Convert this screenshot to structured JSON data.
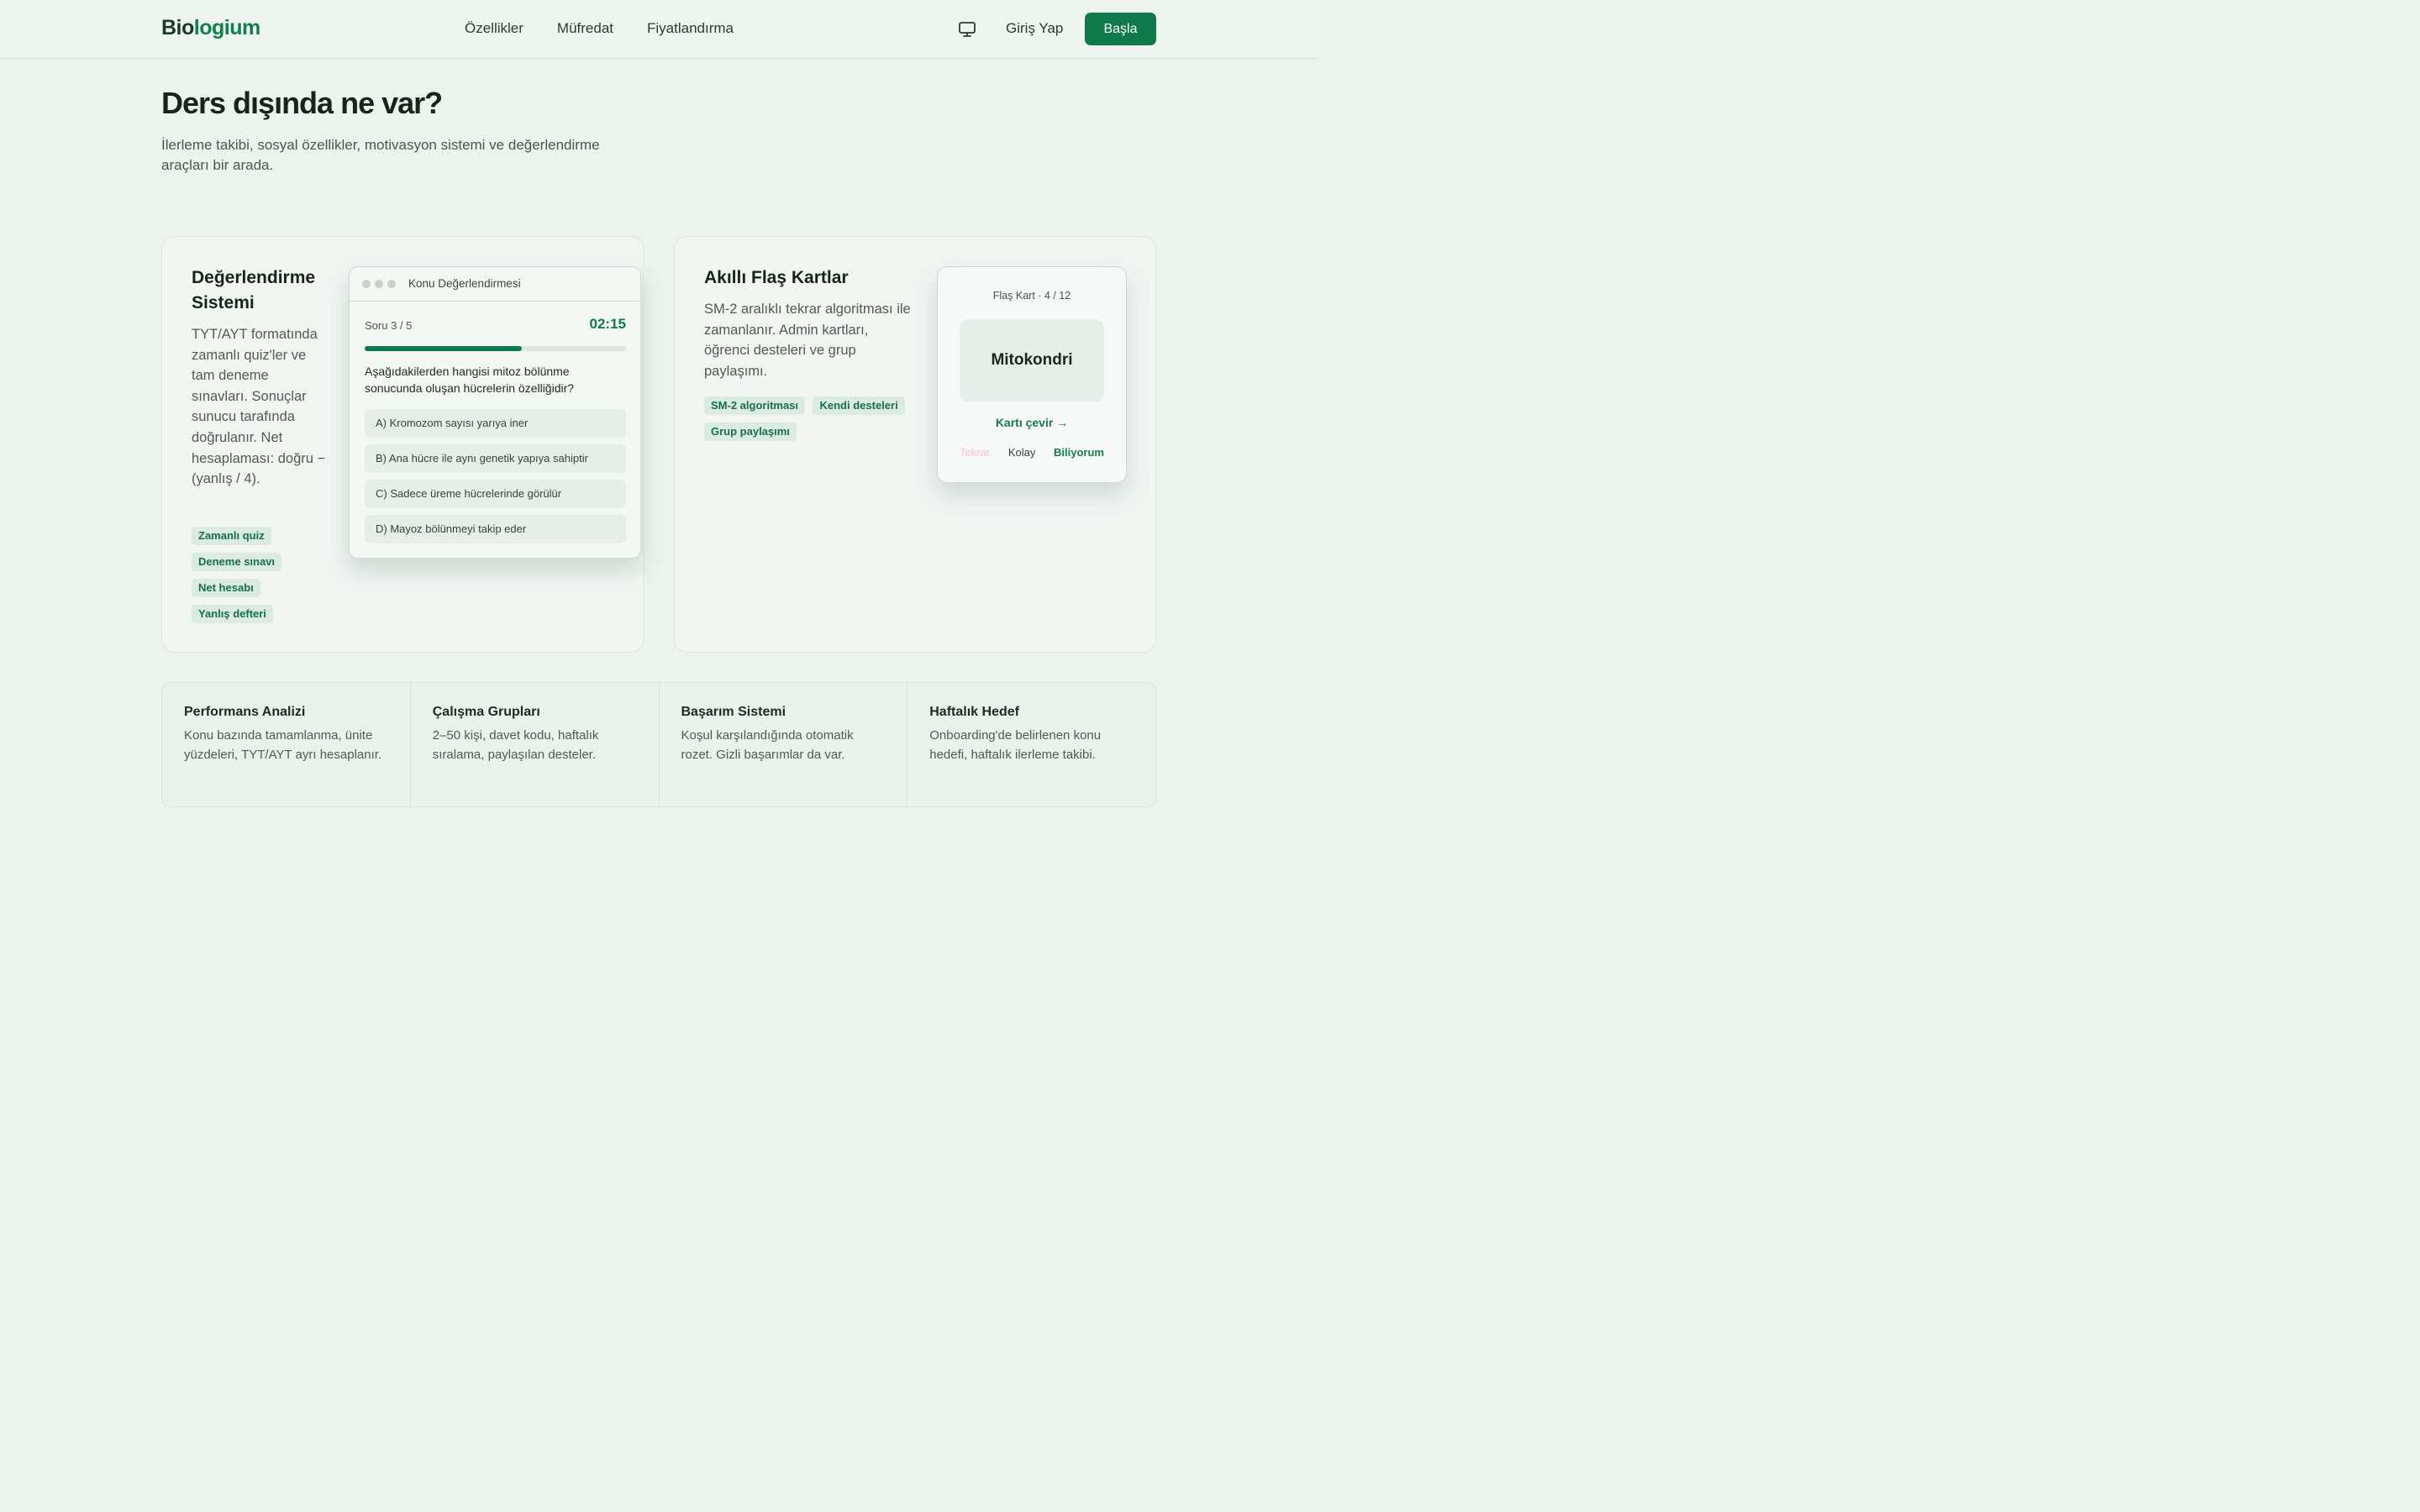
{
  "nav": {
    "logo_a": "Bio",
    "logo_b": "logium",
    "links": [
      "Özellikler",
      "Müfredat",
      "Fiyatlandırma"
    ],
    "login": "Giriş Yap",
    "cta": "Başla"
  },
  "header": {
    "title": "Ders dışında ne var?",
    "lead": "İlerleme takibi, sosyal özellikler, motivasyon sistemi ve değerlendirme araçları bir arada."
  },
  "assessment": {
    "title": "Değerlendirme Sistemi",
    "desc": "TYT/AYT formatında zamanlı quiz'ler ve tam deneme sınavları. Sonuçlar sunucu tarafında doğrulanır. Net hesaplaması: doğru − (yanlış / 4).",
    "tags": [
      "Zamanlı quiz",
      "Deneme sınavı",
      "Net hesabı",
      "Yanlış defteri"
    ],
    "quiz": {
      "window_title": "Konu Değerlendirmesi",
      "counter": "Soru 3 / 5",
      "timer": "02:15",
      "progress": 0.6,
      "question": "Aşağıdakilerden hangisi mitoz bölünme sonucunda oluşan hücrelerin özelliğidir?",
      "options": [
        "A) Kromozom sayısı yarıya iner",
        "B) Ana hücre ile aynı genetik yapıya sahiptir",
        "C) Sadece üreme hücrelerinde görülür",
        "D) Mayoz bölünmeyi takip eder"
      ]
    }
  },
  "flashcards": {
    "title": "Akıllı Flaş Kartlar",
    "desc": "SM-2 aralıklı tekrar algoritması ile zamanlanır. Admin kartları, öğrenci desteleri ve grup paylaşımı.",
    "tags": [
      "SM-2 algoritması",
      "Kendi desteleri",
      "Grup paylaşımı"
    ],
    "widget": {
      "header": "Flaş Kart · 4 / 12",
      "term": "Mitokondri",
      "flip": "Kartı çevir →",
      "answers": [
        "Tekrar",
        "Kolay",
        "Biliyorum"
      ]
    }
  },
  "features": [
    {
      "title": "Performans Analizi",
      "desc": "Konu bazında tamamlanma, ünite yüzdeleri, TYT/AYT ayrı hesaplanır."
    },
    {
      "title": "Çalışma Grupları",
      "desc": "2–50 kişi, davet kodu, haftalık sıralama, paylaşılan desteler."
    },
    {
      "title": "Başarım Sistemi",
      "desc": "Koşul karşılandığında otomatik rozet. Gizli başarımlar da var."
    },
    {
      "title": "Haftalık Hedef",
      "desc": "Onboarding'de belirlenen konu hedefi, haftalık ilerleme takibi."
    }
  ],
  "colors": {
    "brand": "#0e7a4c",
    "background": "#ecf3ee",
    "tag_bg": "#dcebe2"
  },
  "icons": {
    "theme_toggle": "monitor-icon"
  }
}
